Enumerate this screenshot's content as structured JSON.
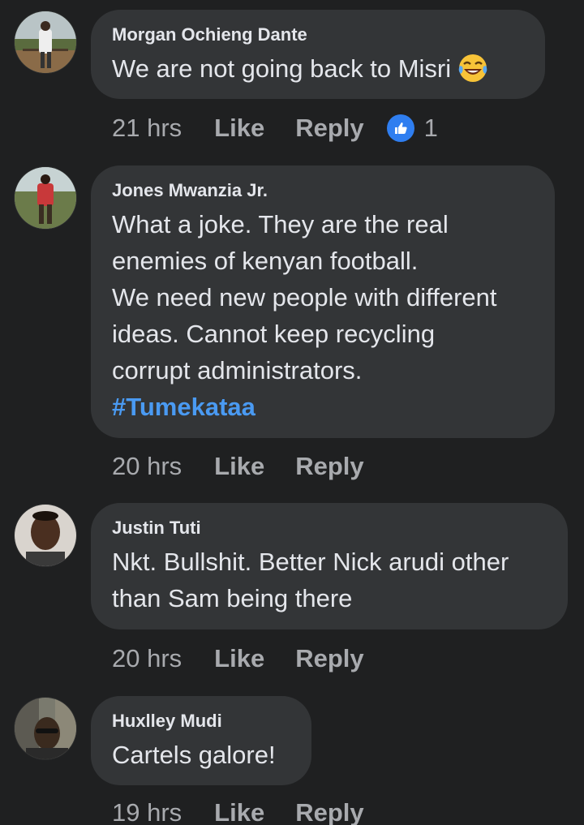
{
  "comments": [
    {
      "author": "Morgan Ochieng Dante",
      "lines": [
        "We are not going back to Misri"
      ],
      "emoji": "laughing-tears",
      "time": "21 hrs",
      "like_label": "Like",
      "reply_label": "Reply",
      "reaction_count": "1"
    },
    {
      "author": "Jones Mwanzia Jr.",
      "lines": [
        "What a joke. They are the real",
        "enemies of kenyan football.",
        "We need new people with different",
        "ideas. Cannot keep recycling",
        "corrupt administrators."
      ],
      "hashtag": "#Tumekataa",
      "time": "20 hrs",
      "like_label": "Like",
      "reply_label": "Reply"
    },
    {
      "author": "Justin Tuti",
      "lines": [
        "Nkt. Bullshit. Better Nick arudi other",
        "than Sam being there"
      ],
      "time": "20 hrs",
      "like_label": "Like",
      "reply_label": "Reply"
    },
    {
      "author": "Huxlley Mudi",
      "lines": [
        "Cartels galore!"
      ],
      "time": "19 hrs",
      "like_label": "Like",
      "reply_label": "Reply"
    }
  ],
  "colors": {
    "background": "#1f2021",
    "bubble": "#333537",
    "hashtag": "#4a9af2",
    "like_reaction": "#2f7ef0"
  }
}
